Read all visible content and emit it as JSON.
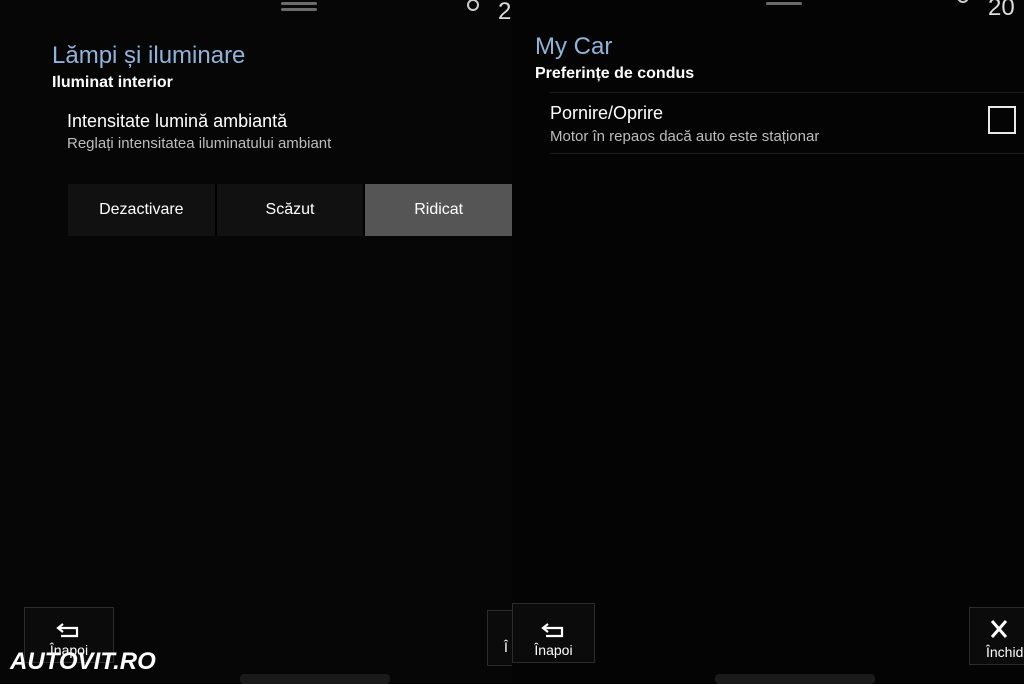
{
  "left": {
    "title": "Lămpi și iluminare",
    "subtitle": "Iluminat interior",
    "setting": {
      "title": "Intensitate lumină ambiantă",
      "description": "Reglați intensitatea iluminatului ambiant"
    },
    "options": [
      "Dezactivare",
      "Scăzut",
      "Ridicat"
    ],
    "selected_option": "Ridicat",
    "clipped_text": "2",
    "back_label": "Înapoi",
    "clipped_button_label": "Î"
  },
  "right": {
    "title": "My Car",
    "subtitle": "Preferințe de condus",
    "setting": {
      "title": "Pornire/Oprire",
      "description": "Motor în repaos dacă auto este staționar",
      "checked": false
    },
    "clipped_text": "20",
    "back_label": "Înapoi",
    "close_label": "Închid"
  },
  "watermark": "AUTOVIT.RO",
  "colors": {
    "title": "#8fb3d9",
    "selected_segment": "#555555",
    "background": "#060606"
  }
}
